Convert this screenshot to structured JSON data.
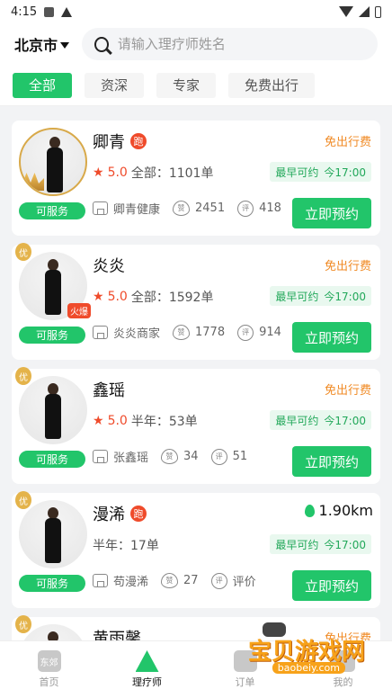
{
  "status_bar": {
    "time": "4:15"
  },
  "header": {
    "city": "北京市",
    "search_placeholder": "请输入理疗师姓名"
  },
  "filters": [
    {
      "label": "全部",
      "active": true
    },
    {
      "label": "资深",
      "active": false
    },
    {
      "label": "专家",
      "active": false
    },
    {
      "label": "免费出行",
      "active": false
    }
  ],
  "cards": [
    {
      "name": "卿青",
      "status": "可服务",
      "fee": "免出行费",
      "rating": "5.0",
      "orders": "全部：1101单",
      "available": "最早可约",
      "available_time": "今17:00",
      "shop": "卿青健康",
      "likes_icon": "赞",
      "likes": "2451",
      "reviews_icon": "评",
      "reviews": "418",
      "book": "立即预约",
      "badge_run": "跑"
    },
    {
      "name": "炎炎",
      "status": "可服务",
      "fee": "免出行费",
      "rating": "5.0",
      "orders": "全部：1592单",
      "available": "最早可约",
      "available_time": "今17:00",
      "shop": "炎炎商家",
      "likes_icon": "赞",
      "likes": "1778",
      "reviews_icon": "评",
      "reviews": "914",
      "book": "立即预约",
      "medal": "优",
      "fire": "火爆"
    },
    {
      "name": "鑫瑶",
      "status": "可服务",
      "fee": "免出行费",
      "rating": "5.0",
      "orders": "半年：53单",
      "available": "最早可约",
      "available_time": "今17:00",
      "shop": "张鑫瑶",
      "likes_icon": "赞",
      "likes": "34",
      "reviews_icon": "评",
      "reviews": "51",
      "book": "立即预约",
      "medal": "优"
    },
    {
      "name": "漫浠",
      "status": "可服务",
      "distance": "1.90km",
      "orders": "半年：17单",
      "available": "最早可约",
      "available_time": "今17:00",
      "shop": "苟漫浠",
      "likes_icon": "赞",
      "likes": "27",
      "reviews_icon": "评",
      "reviews": "评价",
      "book": "立即预约",
      "medal": "优",
      "badge_run": "跑"
    },
    {
      "name": "黄雨馨",
      "fee": "免出行费",
      "medal": "优"
    }
  ],
  "tabbar": [
    {
      "label": "首页",
      "icon": "东郊"
    },
    {
      "label": "理疗师",
      "active": true
    },
    {
      "label": "订单"
    },
    {
      "label": "我的"
    }
  ],
  "watermark": {
    "text": "宝贝游戏网",
    "url": "baobeiy.com"
  }
}
